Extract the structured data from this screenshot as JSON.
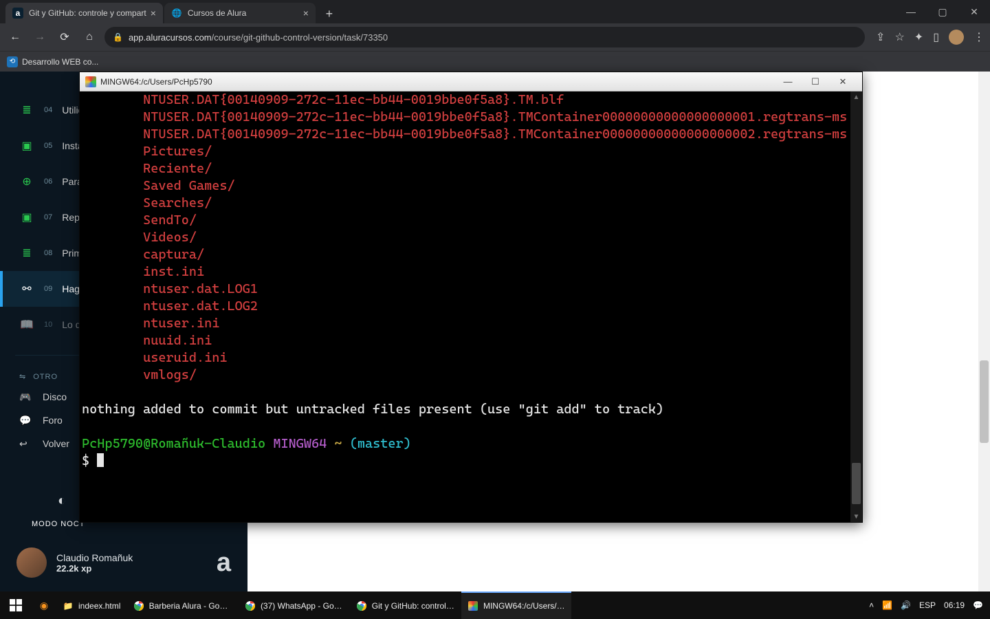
{
  "browser": {
    "tabs": [
      {
        "title": "Git y GitHub: controle y compart",
        "favicon": "a"
      },
      {
        "title": "Cursos de Alura",
        "favicon": "🌐"
      }
    ],
    "url_host": "app.aluracursos.com",
    "url_path": "/course/git-github-control-version/task/73350",
    "bookmark": {
      "label": "Desarrollo WEB co..."
    },
    "winbtns": {
      "min": "—",
      "max": "▢",
      "close": "✕"
    }
  },
  "sidebar": {
    "items": [
      {
        "num": "04",
        "label": "Utilidad",
        "icon": "≣",
        "green": true
      },
      {
        "num": "05",
        "label": "Instala",
        "icon": "▣",
        "green": true
      },
      {
        "num": "06",
        "label": "Para s",
        "icon": "⊕",
        "green": true
      },
      {
        "num": "07",
        "label": "Repos",
        "icon": "▣",
        "green": true
      },
      {
        "num": "08",
        "label": "Primer",
        "icon": "≣",
        "green": true
      },
      {
        "num": "09",
        "label": "Haga l",
        "icon": "⚯",
        "green": false,
        "active": true
      },
      {
        "num": "10",
        "label": "Lo que",
        "icon": "📖",
        "green": false,
        "muted": true
      }
    ],
    "group": "OTRO",
    "subs": [
      {
        "icon": "🎮",
        "label": "Disco"
      },
      {
        "icon": "💬",
        "label": "Foro"
      },
      {
        "icon": "↩",
        "label": "Volver"
      }
    ],
    "mode": "MODO NOCT"
  },
  "user": {
    "name": "Claudio Romañuk",
    "xp": "22.2k xp"
  },
  "terminal": {
    "title": "MINGW64:/c/Users/PcHp5790",
    "winbtns": {
      "min": "—",
      "max": "☐",
      "close": "✕"
    },
    "lines": [
      {
        "indent": "        ",
        "cls": "red",
        "text": "NTUSER.DAT{00140909-272c-11ec-bb44-0019bbe0f5a8}.TM.blf"
      },
      {
        "indent": "        ",
        "cls": "red",
        "text": "NTUSER.DAT{00140909-272c-11ec-bb44-0019bbe0f5a8}.TMContainer00000000000000000001.regtrans-ms",
        "wrap": true
      },
      {
        "indent": "        ",
        "cls": "red",
        "text": "NTUSER.DAT{00140909-272c-11ec-bb44-0019bbe0f5a8}.TMContainer00000000000000000002.regtrans-ms",
        "wrap": true
      },
      {
        "indent": "        ",
        "cls": "red",
        "text": "Pictures/"
      },
      {
        "indent": "        ",
        "cls": "red",
        "text": "Reciente/"
      },
      {
        "indent": "        ",
        "cls": "red",
        "text": "Saved Games/"
      },
      {
        "indent": "        ",
        "cls": "red",
        "text": "Searches/"
      },
      {
        "indent": "        ",
        "cls": "red",
        "text": "SendTo/"
      },
      {
        "indent": "        ",
        "cls": "red",
        "text": "Videos/"
      },
      {
        "indent": "        ",
        "cls": "red",
        "text": "captura/"
      },
      {
        "indent": "        ",
        "cls": "red",
        "text": "inst.ini"
      },
      {
        "indent": "        ",
        "cls": "red",
        "text": "ntuser.dat.LOG1"
      },
      {
        "indent": "        ",
        "cls": "red",
        "text": "ntuser.dat.LOG2"
      },
      {
        "indent": "        ",
        "cls": "red",
        "text": "ntuser.ini"
      },
      {
        "indent": "        ",
        "cls": "red",
        "text": "nuuid.ini"
      },
      {
        "indent": "        ",
        "cls": "red",
        "text": "useruid.ini"
      },
      {
        "indent": "        ",
        "cls": "red",
        "text": "vmlogs/"
      }
    ],
    "status": "nothing added to commit but untracked files present (use \"git add\" to track)",
    "prompt": {
      "user": "PcHp5790@Romañuk-Claudio",
      "sys": "MINGW64",
      "path": "~",
      "branch": "(master)",
      "sym": "$"
    }
  },
  "taskbar": {
    "pinned": [
      {
        "icon": "📁",
        "label": "indeex.html",
        "color": "#ffd36b"
      }
    ],
    "entries": [
      {
        "fav": "chrome",
        "label": "Barberia Alura - Goog..."
      },
      {
        "fav": "chrome",
        "label": "(37) WhatsApp - Goo..."
      },
      {
        "fav": "chrome",
        "label": "Git y GitHub: controle..."
      },
      {
        "fav": "mingw",
        "label": "MINGW64:/c/Users/P...",
        "active": true
      }
    ],
    "tray": {
      "wifi": "📶",
      "vol": "🔊",
      "lang": "ESP",
      "time": "06:19",
      "chat": "💬"
    }
  }
}
